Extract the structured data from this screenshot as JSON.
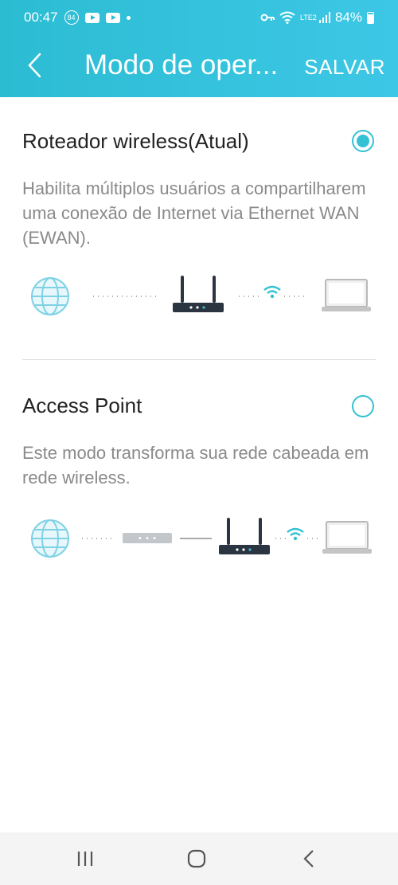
{
  "status_bar": {
    "time": "00:47",
    "notification_badge": "84",
    "network_label": "LTE2",
    "battery": "84%"
  },
  "app_bar": {
    "title": "Modo de oper...",
    "save_label": "SALVAR"
  },
  "options": [
    {
      "title": "Roteador wireless(Atual)",
      "description": "Habilita múltiplos usuários a compartilharem uma conexão de Internet via Ethernet WAN (EWAN).",
      "selected": true
    },
    {
      "title": "Access Point",
      "description": "Este modo transforma sua rede cabeada em rede wireless.",
      "selected": false
    }
  ],
  "colors": {
    "accent": "#35c1d4",
    "header": "#36c3de",
    "description_text": "#8a8a8a"
  },
  "icons": [
    "globe-icon",
    "router-icon",
    "wifi-icon",
    "laptop-icon",
    "modem-icon",
    "back-icon",
    "home-icon",
    "recent-apps-icon"
  ]
}
